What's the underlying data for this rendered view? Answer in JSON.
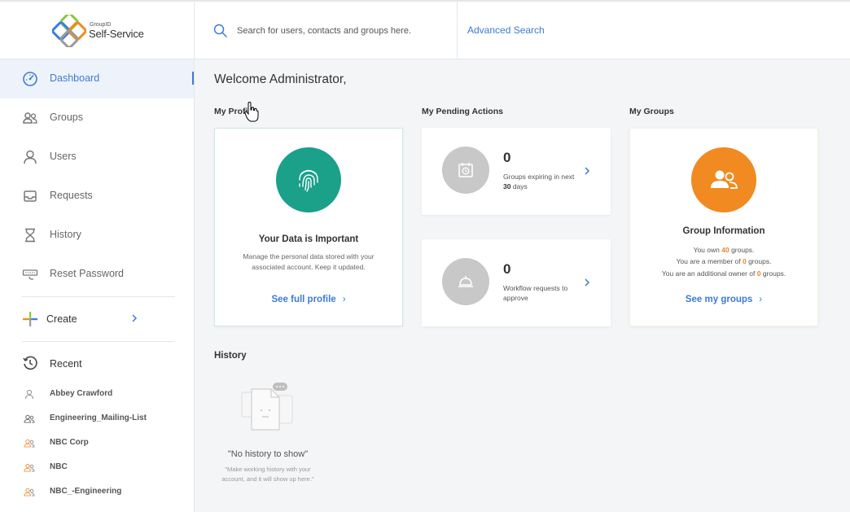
{
  "header": {
    "logo_small": "GroupID",
    "logo_big": "Self-Service",
    "search_placeholder": "Search for users, contacts and groups here.",
    "advanced_search": "Advanced Search"
  },
  "sidebar": {
    "items": [
      {
        "label": "Dashboard",
        "icon": "dashboard-icon",
        "active": true
      },
      {
        "label": "Groups",
        "icon": "groups-icon"
      },
      {
        "label": "Users",
        "icon": "user-icon"
      },
      {
        "label": "Requests",
        "icon": "inbox-icon"
      },
      {
        "label": "History",
        "icon": "hourglass-icon"
      },
      {
        "label": "Reset Password",
        "icon": "keyboard-icon"
      }
    ],
    "create_label": "Create",
    "recent_label": "Recent",
    "recent_items": [
      {
        "label": "Abbey Crawford",
        "icon": "user-icon"
      },
      {
        "label": "Engineering_Mailing-List",
        "icon": "group-icon"
      },
      {
        "label": "NBC Corp",
        "icon": "group-icon"
      },
      {
        "label": "NBC",
        "icon": "group-icon"
      },
      {
        "label": "NBC_-Engineering",
        "icon": "group-icon"
      }
    ]
  },
  "main": {
    "welcome": "Welcome Administrator,",
    "profile": {
      "section_label": "My Profile",
      "title": "Your Data is Important",
      "description": "Manage the personal data stored with your associated account. Keep it updated.",
      "link": "See full profile"
    },
    "pending": {
      "section_label": "My Pending Actions",
      "cards": [
        {
          "count": "0",
          "text_pre": "Groups expiring in next ",
          "text_bold": "30",
          "text_post": " days"
        },
        {
          "count": "0",
          "text_pre": "Workflow requests to approve",
          "text_bold": "",
          "text_post": ""
        }
      ]
    },
    "groups": {
      "section_label": "My Groups",
      "title": "Group Information",
      "lines": [
        {
          "pre": "You own ",
          "num": "40",
          "post": " groups."
        },
        {
          "pre": "You are a member of ",
          "num": "0",
          "post": " groups."
        },
        {
          "pre": "You are an additional owner of ",
          "num": "0",
          "post": " groups."
        }
      ],
      "link": "See my groups"
    },
    "history": {
      "section_label": "History",
      "empty": "\"No history to show\"",
      "sub_1": "\"Make working ",
      "sub_hl": "history",
      "sub_2": " with your account, and it will show up here.\""
    }
  },
  "colors": {
    "accent": "#3d7ad8",
    "teal": "#1ba08a",
    "orange": "#f18a21",
    "grey_circle": "#c8c8c8",
    "highlight_number": "#e8852a"
  }
}
